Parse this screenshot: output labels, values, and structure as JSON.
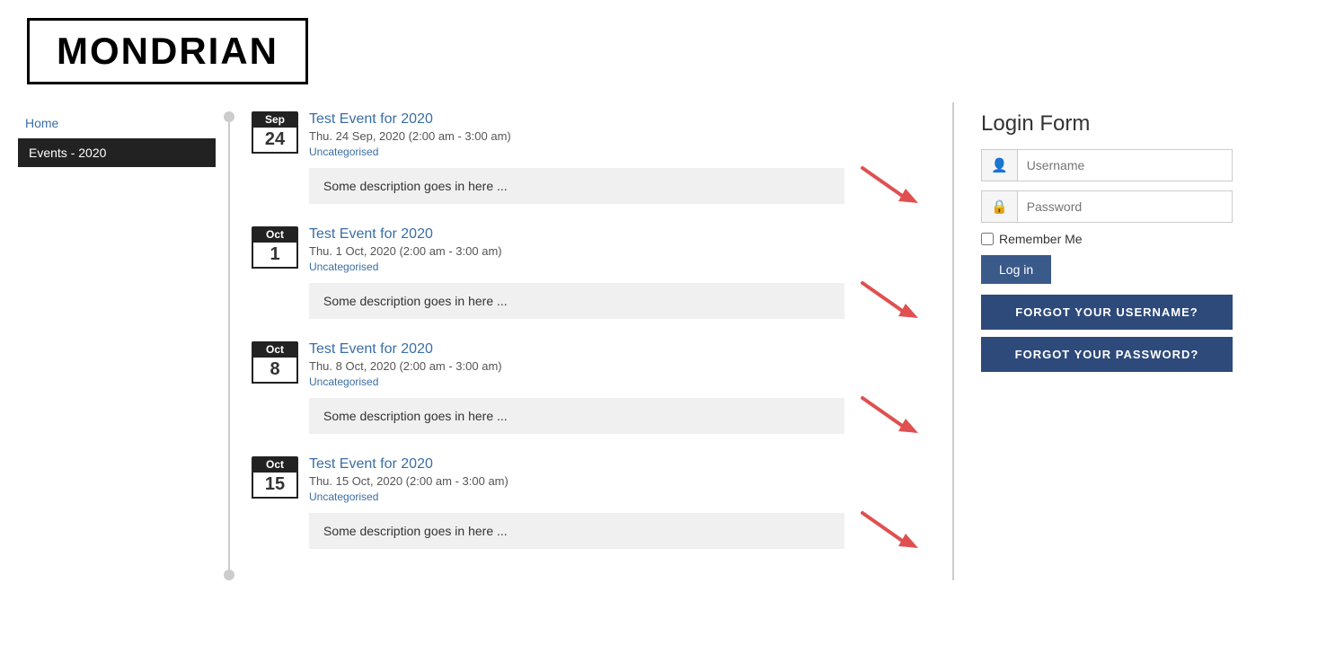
{
  "header": {
    "logo": "MONDRIAN"
  },
  "sidebar": {
    "home_label": "Home",
    "active_label": "Events - 2020"
  },
  "events": [
    {
      "month": "Sep",
      "day": "24",
      "title": "Test Event for 2020",
      "datetime": "Thu. 24 Sep, 2020 (2:00 am - 3:00 am)",
      "category": "Uncategorised",
      "description": "Some description goes in here ..."
    },
    {
      "month": "Oct",
      "day": "1",
      "title": "Test Event for 2020",
      "datetime": "Thu. 1 Oct, 2020 (2:00 am - 3:00 am)",
      "category": "Uncategorised",
      "description": "Some description goes in here ..."
    },
    {
      "month": "Oct",
      "day": "8",
      "title": "Test Event for 2020",
      "datetime": "Thu. 8 Oct, 2020 (2:00 am - 3:00 am)",
      "category": "Uncategorised",
      "description": "Some description goes in here ..."
    },
    {
      "month": "Oct",
      "day": "15",
      "title": "Test Event for 2020",
      "datetime": "Thu. 15 Oct, 2020 (2:00 am - 3:00 am)",
      "category": "Uncategorised",
      "description": "Some description goes in here ..."
    }
  ],
  "login": {
    "title": "Login Form",
    "username_placeholder": "Username",
    "password_placeholder": "Password",
    "remember_label": "Remember Me",
    "login_btn": "Log in",
    "forgot_username_btn": "FORGOT YOUR USERNAME?",
    "forgot_password_btn": "FORGOT YOUR PASSWORD?"
  }
}
